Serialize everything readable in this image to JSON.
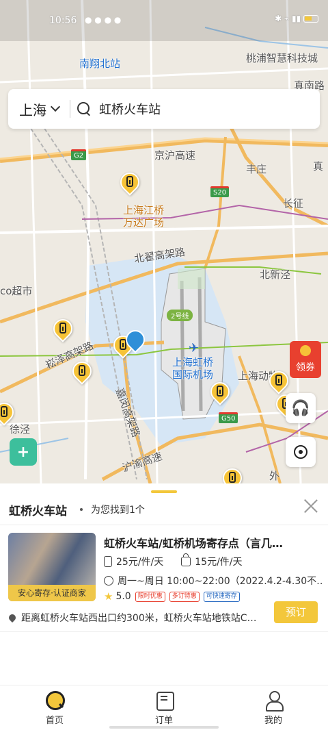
{
  "status_bar": {
    "time": "10:56",
    "battery_icon": "battery-icon"
  },
  "map": {
    "labels": {
      "nanxiang_north": "南翔北站",
      "taopu": "桃浦智慧科技城",
      "zhennan_road": "真南路",
      "g2": "G2",
      "jinghu": "京沪高速",
      "fengzhuang": "丰庄",
      "zhenru": "真",
      "s20": "S20",
      "changzheng": "长征",
      "wanda": "上海江桥\n万达广场",
      "beizhai": "北翟高架路",
      "beixinjing": "北新泾",
      "co_market": "co超市",
      "line2": "2号线",
      "songze": "崧泽高架路",
      "hongqiao_airport": "上海虹桥\n国际机场",
      "zoo": "上海动物",
      "jiamin": "嘉闵高架路",
      "g50": "G50",
      "xujing": "徐泾",
      "huyu": "沪渝高速",
      "wai": "外"
    }
  },
  "search": {
    "city": "上海",
    "query": "虹桥火车站"
  },
  "coupon": {
    "label": "领券"
  },
  "sheet": {
    "title": "虹桥火车站",
    "result_text": "为您找到1个",
    "store": {
      "name": "虹桥火车站/虹桥机场寄存点（言几…",
      "thumb_tag": "安心寄存·认证商家",
      "price_small": "25元/件/天",
      "price_bag": "15元/件/天",
      "hours": "周一~周日 10:00~22:00（2022.4.2-4.30不…",
      "rating": "5.0",
      "badges": [
        "限时优惠",
        "多订特惠",
        "可快速寄存"
      ],
      "address": "距离虹桥火车站西出口约300米，虹桥火车站地铁站C…",
      "book_label": "预订"
    }
  },
  "nav": {
    "items": [
      {
        "label": "首页",
        "icon": "home-search-icon"
      },
      {
        "label": "订单",
        "icon": "order-icon"
      },
      {
        "label": "我的",
        "icon": "profile-icon"
      }
    ]
  },
  "colors": {
    "accent": "#f3c73b",
    "map_bg": "#eeeae2",
    "water": "#d6e6f5",
    "coupon": "#e8402f"
  }
}
